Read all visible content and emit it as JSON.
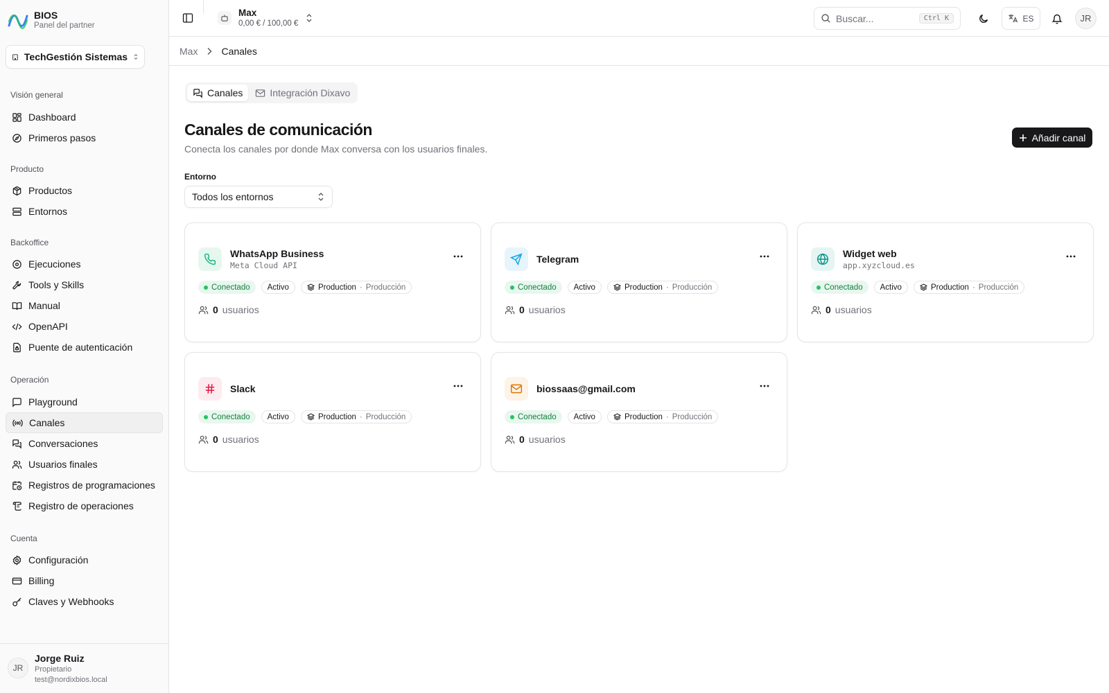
{
  "brand": {
    "name": "BIOS",
    "subtitle": "Panel del partner"
  },
  "org": {
    "name": "TechGestión Sistemas"
  },
  "sidebar": {
    "groups": [
      {
        "title": "Visión general",
        "items": [
          {
            "label": "Dashboard",
            "icon": "dashboard-icon"
          },
          {
            "label": "Primeros pasos",
            "icon": "compass-icon"
          }
        ]
      },
      {
        "title": "Producto",
        "items": [
          {
            "label": "Productos",
            "icon": "package-icon"
          },
          {
            "label": "Entornos",
            "icon": "server-icon"
          }
        ]
      },
      {
        "title": "Backoffice",
        "items": [
          {
            "label": "Ejecuciones",
            "icon": "play-circle-icon"
          },
          {
            "label": "Tools y Skills",
            "icon": "wrench-icon"
          },
          {
            "label": "Manual",
            "icon": "book-icon"
          },
          {
            "label": "OpenAPI",
            "icon": "code-icon"
          },
          {
            "label": "Puente de autenticación",
            "icon": "file-lock-icon"
          }
        ]
      },
      {
        "title": "Operación",
        "items": [
          {
            "label": "Playground",
            "icon": "message-square-icon"
          },
          {
            "label": "Canales",
            "icon": "radio-icon",
            "active": true
          },
          {
            "label": "Conversaciones",
            "icon": "messages-icon"
          },
          {
            "label": "Usuarios finales",
            "icon": "users-icon"
          },
          {
            "label": "Registros de programaciones",
            "icon": "calendar-clock-icon"
          },
          {
            "label": "Registro de operaciones",
            "icon": "scroll-icon"
          }
        ]
      },
      {
        "title": "Cuenta",
        "items": [
          {
            "label": "Configuración",
            "icon": "gear-icon"
          },
          {
            "label": "Billing",
            "icon": "credit-card-icon"
          },
          {
            "label": "Claves y Webhooks",
            "icon": "key-icon"
          }
        ]
      }
    ]
  },
  "user": {
    "initials": "JR",
    "name": "Jorge Ruiz",
    "role": "Propietario",
    "email": "test@nordixbios.local"
  },
  "topbar": {
    "agent_name": "Max",
    "agent_budget": "0,00 € / 100,00 €",
    "search_placeholder": "Buscar...",
    "search_shortcut": "Ctrl K",
    "language": "ES",
    "avatar_initials": "JR"
  },
  "breadcrumb": {
    "parent": "Max",
    "current": "Canales"
  },
  "tabs": [
    {
      "label": "Canales",
      "active": true
    },
    {
      "label": "Integración Dixavo",
      "active": false
    }
  ],
  "page": {
    "title": "Canales de comunicación",
    "description": "Conecta los canales por donde Max conversa con los usuarios finales.",
    "add_button": "Añadir canal"
  },
  "filter": {
    "label": "Entorno",
    "value": "Todos los entornos"
  },
  "channels": [
    {
      "name": "WhatsApp Business",
      "subtitle": "Meta Cloud API",
      "icon": "phone-icon",
      "color": "#10b981",
      "bg": "#e7f7f0",
      "status": "Conectado",
      "state": "Activo",
      "env_name": "Production",
      "env_label": "Producción",
      "users_count": "0",
      "users_unit": "usuarios"
    },
    {
      "name": "Telegram",
      "subtitle": "",
      "icon": "send-icon",
      "color": "#0ea5e9",
      "bg": "#e6f5fc",
      "status": "Conectado",
      "state": "Activo",
      "env_name": "Production",
      "env_label": "Producción",
      "users_count": "0",
      "users_unit": "usuarios"
    },
    {
      "name": "Widget web",
      "subtitle": "app.xyzcloud.es",
      "icon": "globe-icon",
      "color": "#0d9488",
      "bg": "#e6f5f3",
      "status": "Conectado",
      "state": "Activo",
      "env_name": "Production",
      "env_label": "Producción",
      "users_count": "0",
      "users_unit": "usuarios"
    },
    {
      "name": "Slack",
      "subtitle": "",
      "icon": "hash-icon",
      "color": "#e11d48",
      "bg": "#fdecef",
      "status": "Conectado",
      "state": "Activo",
      "env_name": "Production",
      "env_label": "Producción",
      "users_count": "0",
      "users_unit": "usuarios"
    },
    {
      "name": "biossaas@gmail.com",
      "subtitle": "",
      "icon": "mail-icon",
      "color": "#d97706",
      "bg": "#fdf3e6",
      "status": "Conectado",
      "state": "Activo",
      "env_name": "Production",
      "env_label": "Producción",
      "users_count": "0",
      "users_unit": "usuarios"
    }
  ]
}
